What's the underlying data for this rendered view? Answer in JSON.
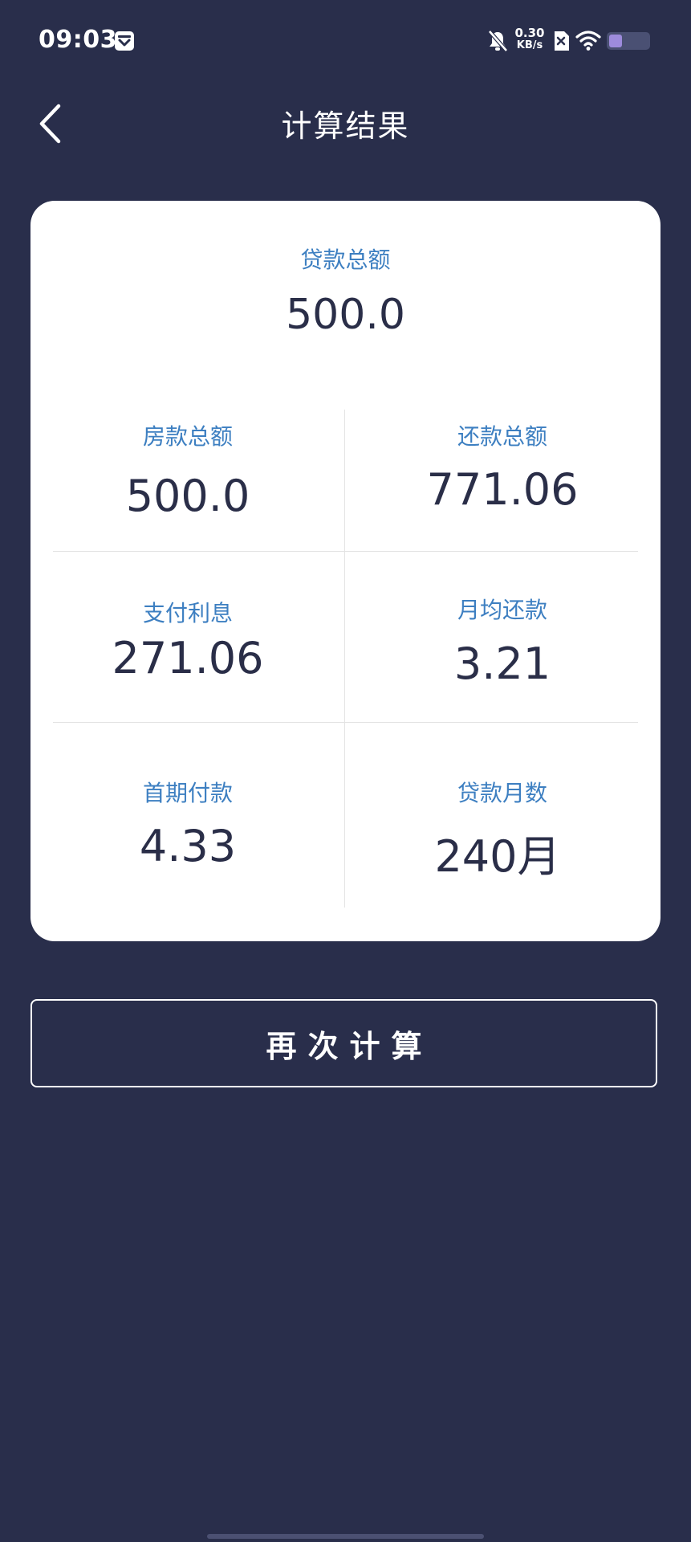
{
  "status_bar": {
    "time": "09:03",
    "network_speed_value": "0.30",
    "network_speed_unit": "KB/s",
    "battery_level": 0.33,
    "icons": [
      "app-notification-icon",
      "mute-bell-icon",
      "sim-off-icon",
      "wifi-icon",
      "battery-icon"
    ]
  },
  "header": {
    "title": "计算结果",
    "back_icon": "chevron-left-icon"
  },
  "result": {
    "loan_total_label": "贷款总额",
    "loan_total_value": "500.0",
    "cells": [
      {
        "label": "房款总额",
        "value": "500.0"
      },
      {
        "label": "还款总额",
        "value": "771.06"
      },
      {
        "label": "支付利息",
        "value": "271.06"
      },
      {
        "label": "月均还款",
        "value": "3.21"
      },
      {
        "label": "首期付款",
        "value": "4.33"
      },
      {
        "label": "贷款月数",
        "value": "240月"
      }
    ]
  },
  "actions": {
    "recalculate_label": "再次计算"
  },
  "colors": {
    "background": "#292e4b",
    "card": "#ffffff",
    "label_blue": "#3d7fc1",
    "value_dark": "#2a2e48",
    "battery_fill": "#9d8bdc"
  }
}
